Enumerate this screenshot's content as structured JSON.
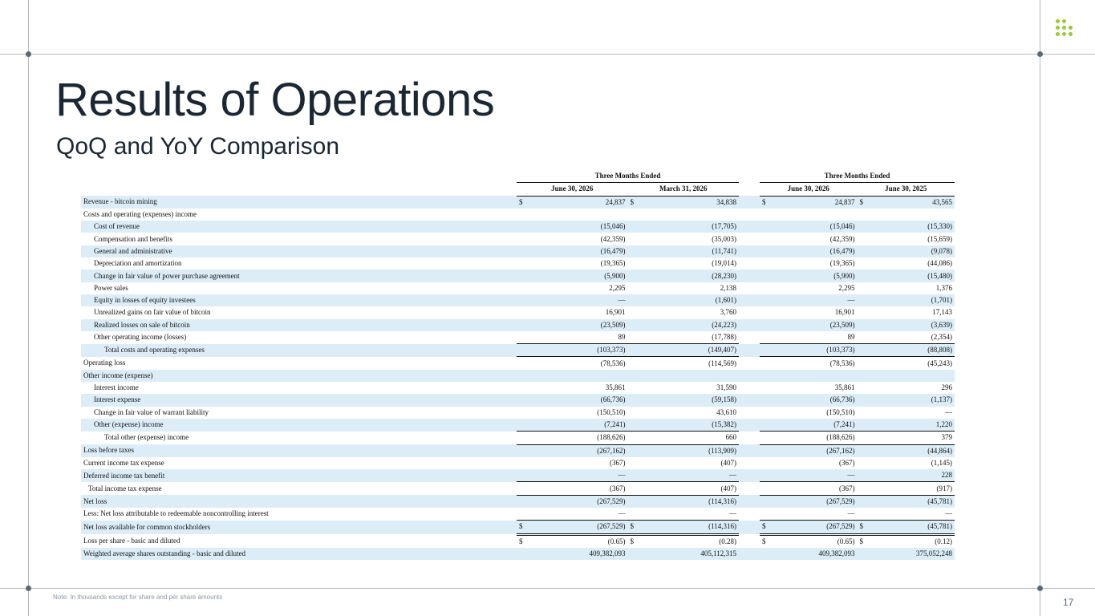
{
  "title": "Results of Operations",
  "subtitle": "QoQ and YoY Comparison",
  "note": "Note: In thousands except for share and per share amounts",
  "page_number": "17",
  "accent_color": "#9cc93b",
  "row_highlight_color": "#dcedf8",
  "table": {
    "group_headers": [
      "Three Months Ended",
      "Three Months Ended"
    ],
    "columns": [
      "June 30, 2026",
      "March 31, 2026",
      "June 30, 2026",
      "June 30, 2025"
    ],
    "rows": [
      {
        "label": "Revenue - bitcoin mining",
        "indent": 0,
        "dollar": true,
        "values": [
          "24,837",
          "34,838",
          "24,837",
          "43,565"
        ]
      },
      {
        "label": "Costs and operating (expenses) income",
        "indent": 0,
        "values": [
          "",
          "",
          "",
          ""
        ]
      },
      {
        "label": "Cost of revenue",
        "indent": 1,
        "values": [
          "(15,046)",
          "(17,705)",
          "(15,046)",
          "(15,330)"
        ]
      },
      {
        "label": "Compensation and benefits",
        "indent": 1,
        "values": [
          "(42,359)",
          "(35,003)",
          "(42,359)",
          "(15,659)"
        ]
      },
      {
        "label": "General and administrative",
        "indent": 1,
        "values": [
          "(16,479)",
          "(11,741)",
          "(16,479)",
          "(9,078)"
        ]
      },
      {
        "label": "Depreciation and amortization",
        "indent": 1,
        "values": [
          "(19,365)",
          "(19,014)",
          "(19,365)",
          "(44,086)"
        ]
      },
      {
        "label": "Change in fair value of power purchase agreement",
        "indent": 1,
        "values": [
          "(5,900)",
          "(28,230)",
          "(5,900)",
          "(15,480)"
        ]
      },
      {
        "label": "Power sales",
        "indent": 1,
        "values": [
          "2,295",
          "2,138",
          "2,295",
          "1,376"
        ]
      },
      {
        "label": "Equity in losses of equity investees",
        "indent": 1,
        "values": [
          "—",
          "(1,601)",
          "—",
          "(1,701)"
        ]
      },
      {
        "label": "Unrealized gains on fair value of bitcoin",
        "indent": 1,
        "values": [
          "16,901",
          "3,760",
          "16,901",
          "17,143"
        ]
      },
      {
        "label": "Realized losses on sale of bitcoin",
        "indent": 1,
        "values": [
          "(23,509)",
          "(24,223)",
          "(23,509)",
          "(3,639)"
        ]
      },
      {
        "label": "Other operating income (losses)",
        "indent": 1,
        "values": [
          "89",
          "(17,788)",
          "89",
          "(2,354)"
        ]
      },
      {
        "label": "Total costs and operating expenses",
        "indent": 2,
        "line": "top",
        "values": [
          "(103,373)",
          "(149,407)",
          "(103,373)",
          "(88,808)"
        ]
      },
      {
        "label": "Operating loss",
        "indent": 0,
        "line": "top",
        "values": [
          "(78,536)",
          "(114,569)",
          "(78,536)",
          "(45,243)"
        ]
      },
      {
        "label": "Other income (expense)",
        "indent": 0,
        "values": [
          "",
          "",
          "",
          ""
        ]
      },
      {
        "label": "Interest income",
        "indent": 1,
        "values": [
          "35,861",
          "31,590",
          "35,861",
          "296"
        ]
      },
      {
        "label": "Interest expense",
        "indent": 1,
        "values": [
          "(66,736)",
          "(59,158)",
          "(66,736)",
          "(1,137)"
        ]
      },
      {
        "label": "Change in fair value of warrant liability",
        "indent": 1,
        "values": [
          "(150,510)",
          "43,610",
          "(150,510)",
          "—"
        ]
      },
      {
        "label": "Other (expense) income",
        "indent": 1,
        "values": [
          "(7,241)",
          "(15,382)",
          "(7,241)",
          "1,220"
        ]
      },
      {
        "label": "Total other (expense) income",
        "indent": 2,
        "line": "top",
        "values": [
          "(188,626)",
          "660",
          "(188,626)",
          "379"
        ]
      },
      {
        "label": "Loss before taxes",
        "indent": 0,
        "line": "top",
        "values": [
          "(267,162)",
          "(113,909)",
          "(267,162)",
          "(44,864)"
        ]
      },
      {
        "label": "Current income tax expense",
        "indent": 0,
        "values": [
          "(367)",
          "(407)",
          "(367)",
          "(1,145)"
        ]
      },
      {
        "label": "Deferred income tax benefit",
        "indent": 0,
        "values": [
          "—",
          "—",
          "—",
          "228"
        ]
      },
      {
        "label": "Total income tax expense",
        "indent": 3,
        "line": "top",
        "values": [
          "(367)",
          "(407)",
          "(367)",
          "(917)"
        ]
      },
      {
        "label": "Net loss",
        "indent": 0,
        "line": "top",
        "values": [
          "(267,529)",
          "(114,316)",
          "(267,529)",
          "(45,781)"
        ]
      },
      {
        "label": "Less: Net loss attributable to redeemable noncontrolling interest",
        "indent": 0,
        "values": [
          "—",
          "—",
          "—",
          "—"
        ]
      },
      {
        "label": "Net loss available for common stockholders",
        "indent": 0,
        "line": "top-double",
        "dollar": true,
        "values": [
          "(267,529)",
          "(114,316)",
          "(267,529)",
          "(45,781)"
        ]
      },
      {
        "label": "Loss per share - basic and diluted",
        "indent": 0,
        "dollar": true,
        "values": [
          "(0.65)",
          "(0.28)",
          "(0.65)",
          "(0.12)"
        ]
      },
      {
        "label": "Weighted average shares outstanding - basic and diluted",
        "indent": 0,
        "values": [
          "409,382,093",
          "405,112,315",
          "409,382,093",
          "375,052,248"
        ]
      }
    ]
  }
}
